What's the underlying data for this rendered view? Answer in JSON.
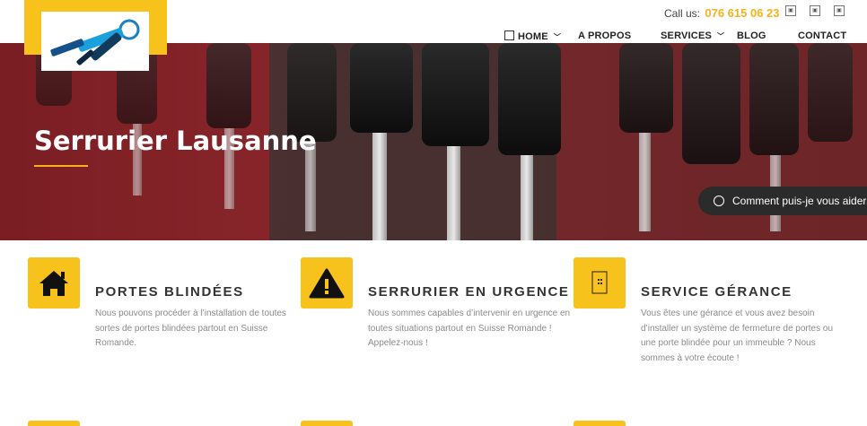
{
  "header": {
    "call_label": "Call us:",
    "phone": "076 615 06 23",
    "social_icons": [
      "social-icon-1",
      "social-icon-2",
      "social-icon-3"
    ]
  },
  "nav": {
    "items": [
      {
        "label": "HOME",
        "dropdown": true
      },
      {
        "label": "A PROPOS",
        "dropdown": false
      },
      {
        "label": "SERVICES",
        "dropdown": true
      },
      {
        "label": "BLOG",
        "dropdown": false
      },
      {
        "label": "CONTACT",
        "dropdown": false
      }
    ]
  },
  "hero": {
    "title": "Serrurier Lausanne",
    "chat_label": "Comment puis-je vous aider ?"
  },
  "services": [
    {
      "icon": "home-icon",
      "title": "PORTES BLINDÉES",
      "text": "Nous pouvons procéder à l’installation de toutes sortes de portes blindées partout en Suisse Romande."
    },
    {
      "icon": "warning-icon",
      "title": "SERRURIER EN URGENCE",
      "text": "Nous sommes capables d’intervenir en urgence en toutes situations partout en Suisse Romande ! Appelez-nous !"
    },
    {
      "icon": "building-icon",
      "title": "SERVICE GÉRANCE",
      "text": "Vous êtes une gérance et vous avez besoin d’installer un système de fermeture de portes ou une porte blindée pour un immeuble ? Nous sommes à votre écoute !"
    }
  ],
  "colors": {
    "accent": "#f6c21b",
    "phone": "#f6b21b",
    "dark": "#2b2b2b"
  }
}
